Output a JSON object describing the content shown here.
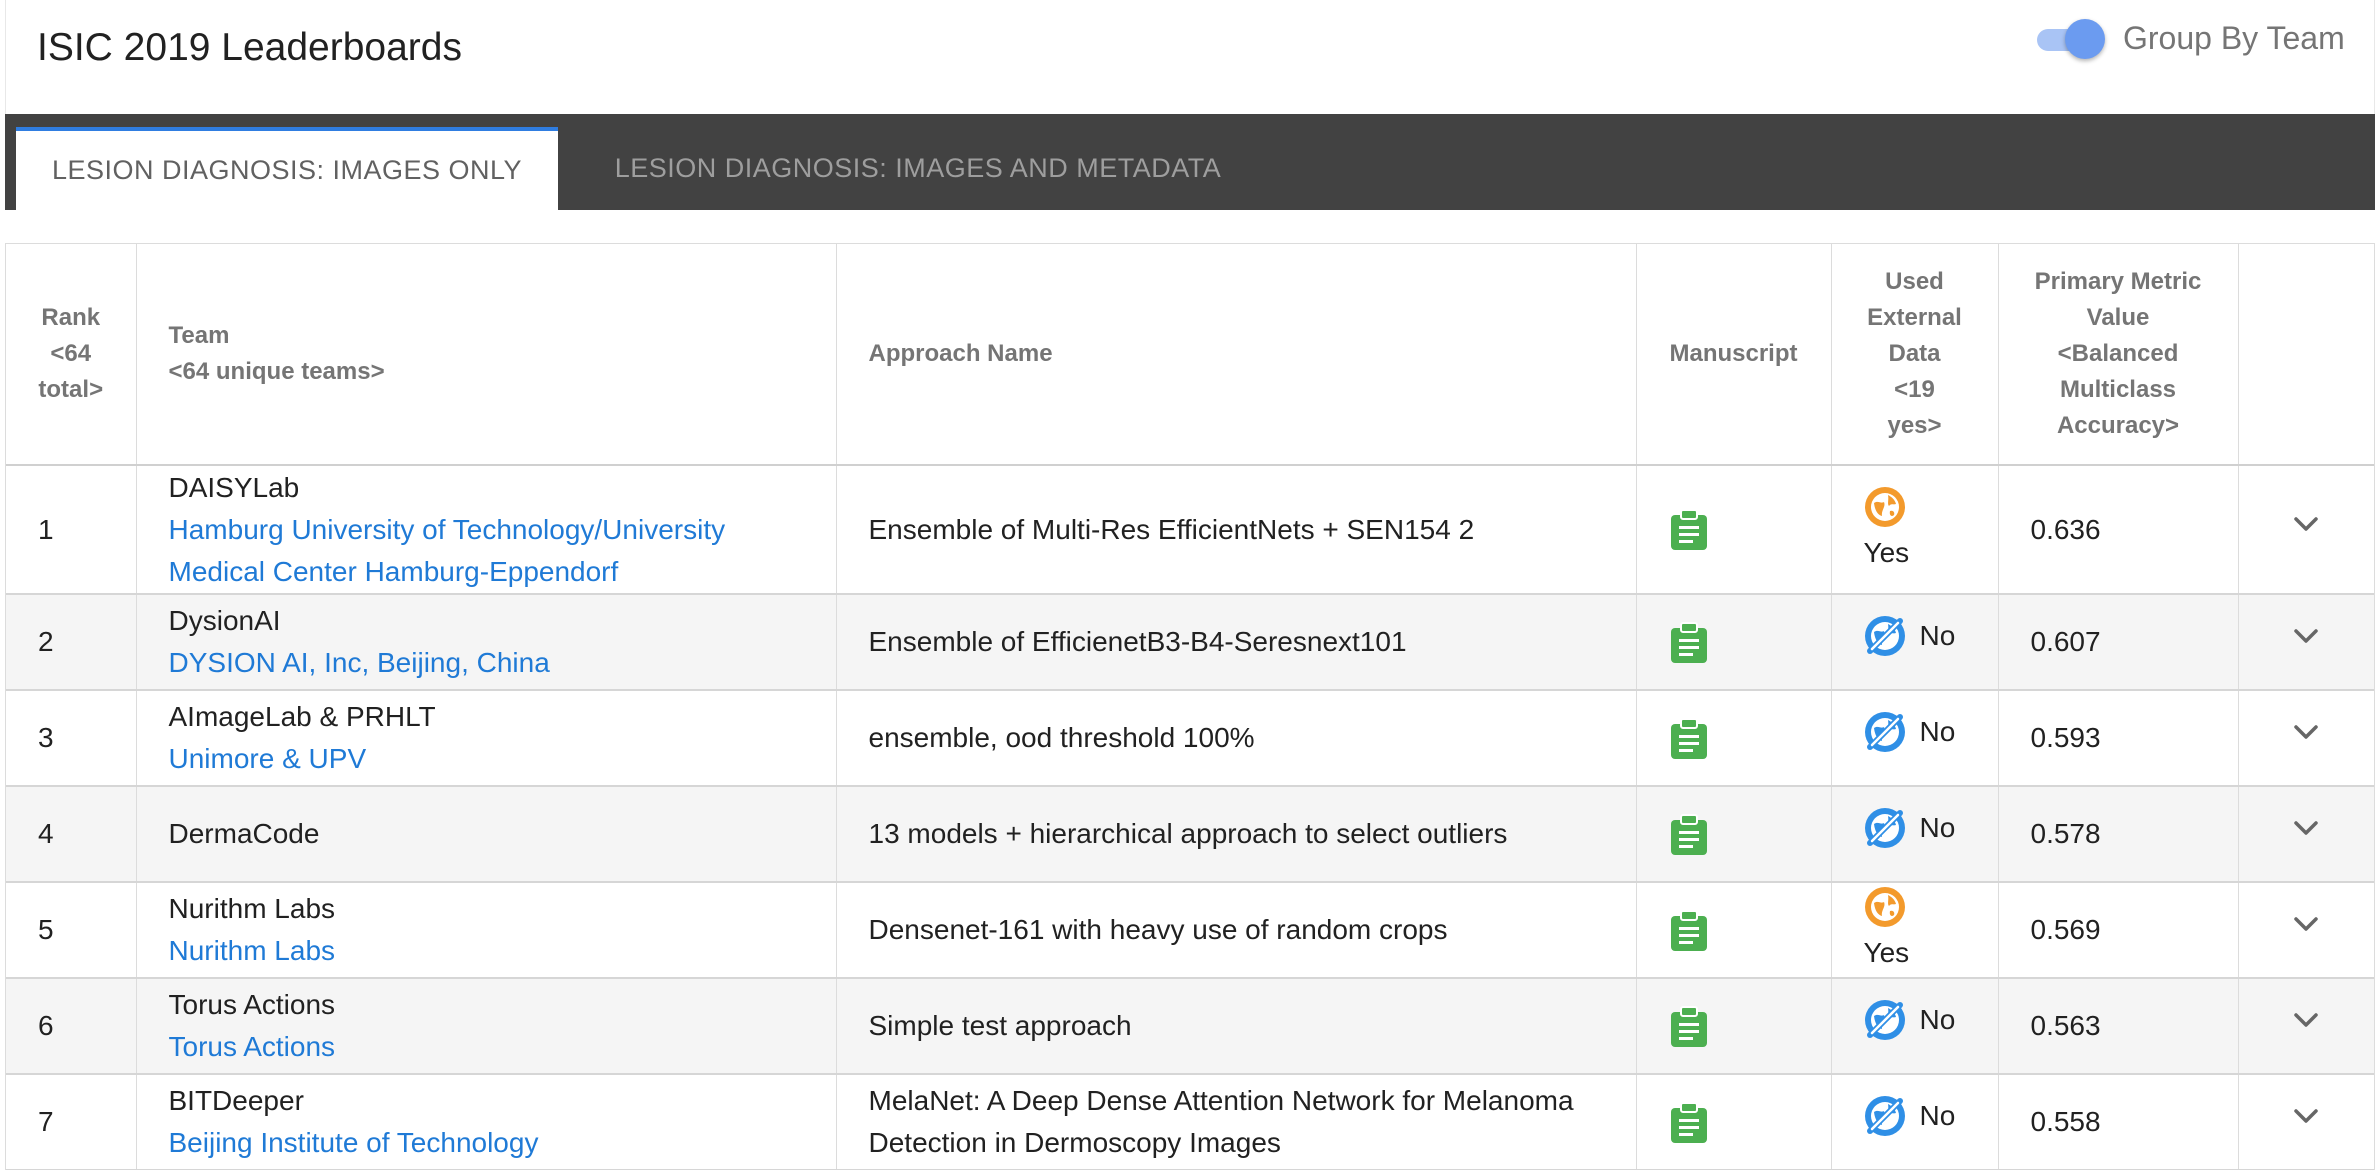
{
  "app": {
    "title": "ISIC 2019 Leaderboards"
  },
  "toggle": {
    "label": "Group By Team",
    "on": true,
    "color": "#6b9bf0"
  },
  "tabs": [
    {
      "label": "LESION DIAGNOSIS: IMAGES ONLY",
      "active": true
    },
    {
      "label": "LESION DIAGNOSIS: IMAGES AND METADATA",
      "active": false
    }
  ],
  "table": {
    "headers": {
      "rank": "Rank\n<64\ntotal>",
      "team": "Team\n<64 unique teams>",
      "approach": "Approach Name",
      "manuscript": "Manuscript",
      "external": "Used\nExternal\nData\n<19\nyes>",
      "metric": "Primary Metric\nValue\n<Balanced\nMulticlass\nAccuracy>"
    },
    "rows": [
      {
        "rank": "1",
        "team": "DAISYLab",
        "affiliation": "Hamburg University of Technology/University Medical Center Hamburg-Eppendorf",
        "approach": "Ensemble of Multi-Res EfficientNets + SEN154 2",
        "external": "Yes",
        "external_icon": "globe-icon",
        "metric": "0.636"
      },
      {
        "rank": "2",
        "team": "DysionAI",
        "affiliation": "DYSION AI, Inc, Beijing, China",
        "approach": "Ensemble of EfficienetB3-B4-Seresnext101",
        "external": "No",
        "external_icon": "globe-off-icon",
        "metric": "0.607"
      },
      {
        "rank": "3",
        "team": "AImageLab & PRHLT",
        "affiliation": "Unimore & UPV",
        "approach": "ensemble, ood threshold 100%",
        "external": "No",
        "external_icon": "globe-off-icon",
        "metric": "0.593"
      },
      {
        "rank": "4",
        "team": "DermaCode",
        "affiliation": "",
        "approach": "13 models + hierarchical approach to select outliers",
        "external": "No",
        "external_icon": "globe-off-icon",
        "metric": "0.578"
      },
      {
        "rank": "5",
        "team": "Nurithm Labs",
        "affiliation": "Nurithm Labs",
        "approach": "Densenet-161 with heavy use of random crops",
        "external": "Yes",
        "external_icon": "globe-icon",
        "metric": "0.569"
      },
      {
        "rank": "6",
        "team": "Torus Actions",
        "affiliation": "Torus Actions",
        "approach": "Simple test approach",
        "external": "No",
        "external_icon": "globe-off-icon",
        "metric": "0.563"
      },
      {
        "rank": "7",
        "team": "BITDeeper",
        "affiliation": "Beijing Institute of Technology",
        "approach": "MelaNet: A Deep Dense Attention Network for Melanoma Detection in Dermoscopy Images",
        "external": "No",
        "external_icon": "globe-off-icon",
        "metric": "0.558"
      }
    ]
  },
  "colors": {
    "tab_bar": "#424242",
    "tab_indicator": "#2f7de1",
    "link": "#1f7ad6",
    "manuscript_icon": "#4caf50",
    "external_yes": "#f39a2c",
    "external_no": "#2f8fe6"
  },
  "icons": {
    "manuscript": "clipboard-icon",
    "expand": "chevron-down-icon"
  }
}
